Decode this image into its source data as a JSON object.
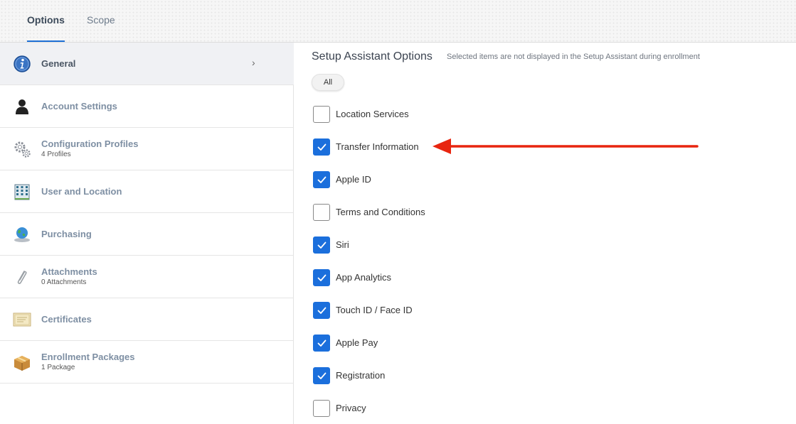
{
  "tabs": {
    "options": "Options",
    "scope": "Scope"
  },
  "sidebar": {
    "items": [
      {
        "label": "General",
        "sub": "",
        "icon": "info-icon",
        "active": true
      },
      {
        "label": "Account Settings",
        "sub": "",
        "icon": "user-icon",
        "active": false
      },
      {
        "label": "Configuration Profiles",
        "sub": "4 Profiles",
        "icon": "gear-icon",
        "active": false
      },
      {
        "label": "User and Location",
        "sub": "",
        "icon": "building-icon",
        "active": false
      },
      {
        "label": "Purchasing",
        "sub": "",
        "icon": "globe-icon",
        "active": false
      },
      {
        "label": "Attachments",
        "sub": "0 Attachments",
        "icon": "paperclip-icon",
        "active": false
      },
      {
        "label": "Certificates",
        "sub": "",
        "icon": "certificate-icon",
        "active": false
      },
      {
        "label": "Enrollment Packages",
        "sub": "1 Package",
        "icon": "package-icon",
        "active": false
      }
    ]
  },
  "main": {
    "title": "Setup Assistant Options",
    "note": "Selected items are not displayed in the Setup Assistant during enrollment",
    "all_label": "All",
    "options": [
      {
        "label": "Location Services",
        "checked": false
      },
      {
        "label": "Transfer Information",
        "checked": true
      },
      {
        "label": "Apple ID",
        "checked": true
      },
      {
        "label": "Terms and Conditions",
        "checked": false
      },
      {
        "label": "Siri",
        "checked": true
      },
      {
        "label": "App Analytics",
        "checked": true
      },
      {
        "label": "Touch ID / Face ID",
        "checked": true
      },
      {
        "label": "Apple Pay",
        "checked": true
      },
      {
        "label": "Registration",
        "checked": true
      },
      {
        "label": "Privacy",
        "checked": false
      }
    ]
  },
  "colors": {
    "accent": "#1b6fdc",
    "arrow": "#e8250f"
  }
}
